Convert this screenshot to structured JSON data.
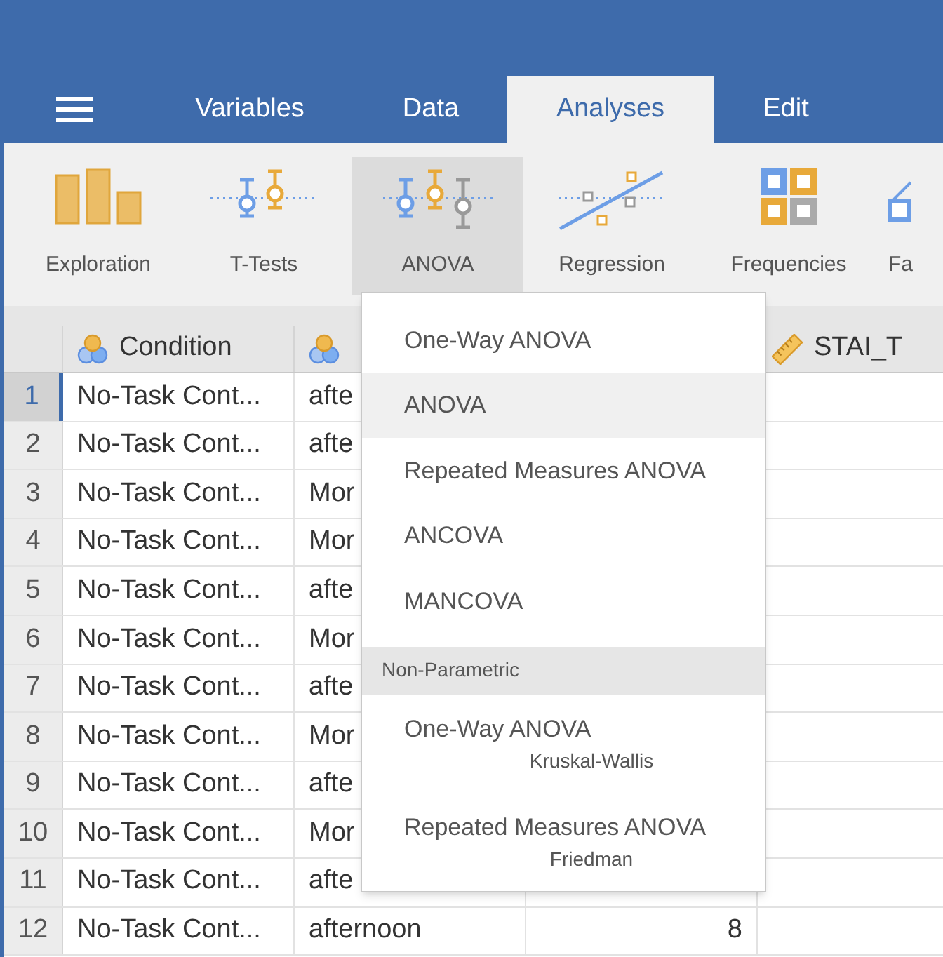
{
  "tabs": [
    {
      "label": "Variables",
      "selected": false
    },
    {
      "label": "Data",
      "selected": false
    },
    {
      "label": "Analyses",
      "selected": true
    },
    {
      "label": "Edit",
      "selected": false
    }
  ],
  "ribbon": [
    {
      "label": "Exploration",
      "kind": "exploration",
      "selected": false
    },
    {
      "label": "T-Tests",
      "kind": "ttests",
      "selected": false
    },
    {
      "label": "ANOVA",
      "kind": "anova",
      "selected": true
    },
    {
      "label": "Regression",
      "kind": "regression",
      "selected": false
    },
    {
      "label": "Frequencies",
      "kind": "frequencies",
      "selected": false
    },
    {
      "label": "Fa",
      "kind": "factor",
      "selected": false
    }
  ],
  "table": {
    "columns": [
      {
        "name": "Condition",
        "kind": "nominal"
      },
      {
        "kind": "nominal"
      },
      {
        "kind": "blank"
      },
      {
        "name": "STAI_T",
        "kind": "continuous"
      }
    ],
    "rows": [
      {
        "number": "1",
        "selected": true,
        "cells": [
          "No-Task Cont...",
          "afte"
        ]
      },
      {
        "number": "2",
        "selected": false,
        "cells": [
          "No-Task Cont...",
          "afte"
        ]
      },
      {
        "number": "3",
        "selected": false,
        "cells": [
          "No-Task Cont...",
          "Mor"
        ]
      },
      {
        "number": "4",
        "selected": false,
        "cells": [
          "No-Task Cont...",
          "Mor"
        ]
      },
      {
        "number": "5",
        "selected": false,
        "cells": [
          "No-Task Cont...",
          "afte"
        ]
      },
      {
        "number": "6",
        "selected": false,
        "cells": [
          "No-Task Cont...",
          "Mor"
        ]
      },
      {
        "number": "7",
        "selected": false,
        "cells": [
          "No-Task Cont...",
          "afte"
        ]
      },
      {
        "number": "8",
        "selected": false,
        "cells": [
          "No-Task Cont...",
          "Mor"
        ]
      },
      {
        "number": "9",
        "selected": false,
        "cells": [
          "No-Task Cont...",
          "afte"
        ]
      },
      {
        "number": "10",
        "selected": false,
        "cells": [
          "No-Task Cont...",
          "Mor"
        ]
      },
      {
        "number": "11",
        "selected": false,
        "cells": [
          "No-Task Cont...",
          "afte"
        ]
      },
      {
        "number": "12",
        "selected": false,
        "cells": [
          "No-Task Cont...",
          "afternoon",
          "8"
        ]
      }
    ]
  },
  "menu": [
    {
      "kind": "item",
      "label": "One-Way ANOVA",
      "selected": false
    },
    {
      "kind": "item",
      "label": "ANOVA",
      "selected": true
    },
    {
      "kind": "item",
      "label": "Repeated Measures ANOVA",
      "selected": false
    },
    {
      "kind": "item",
      "label": "ANCOVA",
      "selected": false
    },
    {
      "kind": "item",
      "label": "MANCOVA",
      "selected": false
    },
    {
      "kind": "header",
      "label": "Non-Parametric"
    },
    {
      "kind": "item",
      "label": "One-Way ANOVA",
      "sublabel": "Kruskal-Wallis",
      "selected": false
    },
    {
      "kind": "item",
      "label": "Repeated Measures ANOVA",
      "sublabel": "Friedman",
      "selected": false
    }
  ]
}
